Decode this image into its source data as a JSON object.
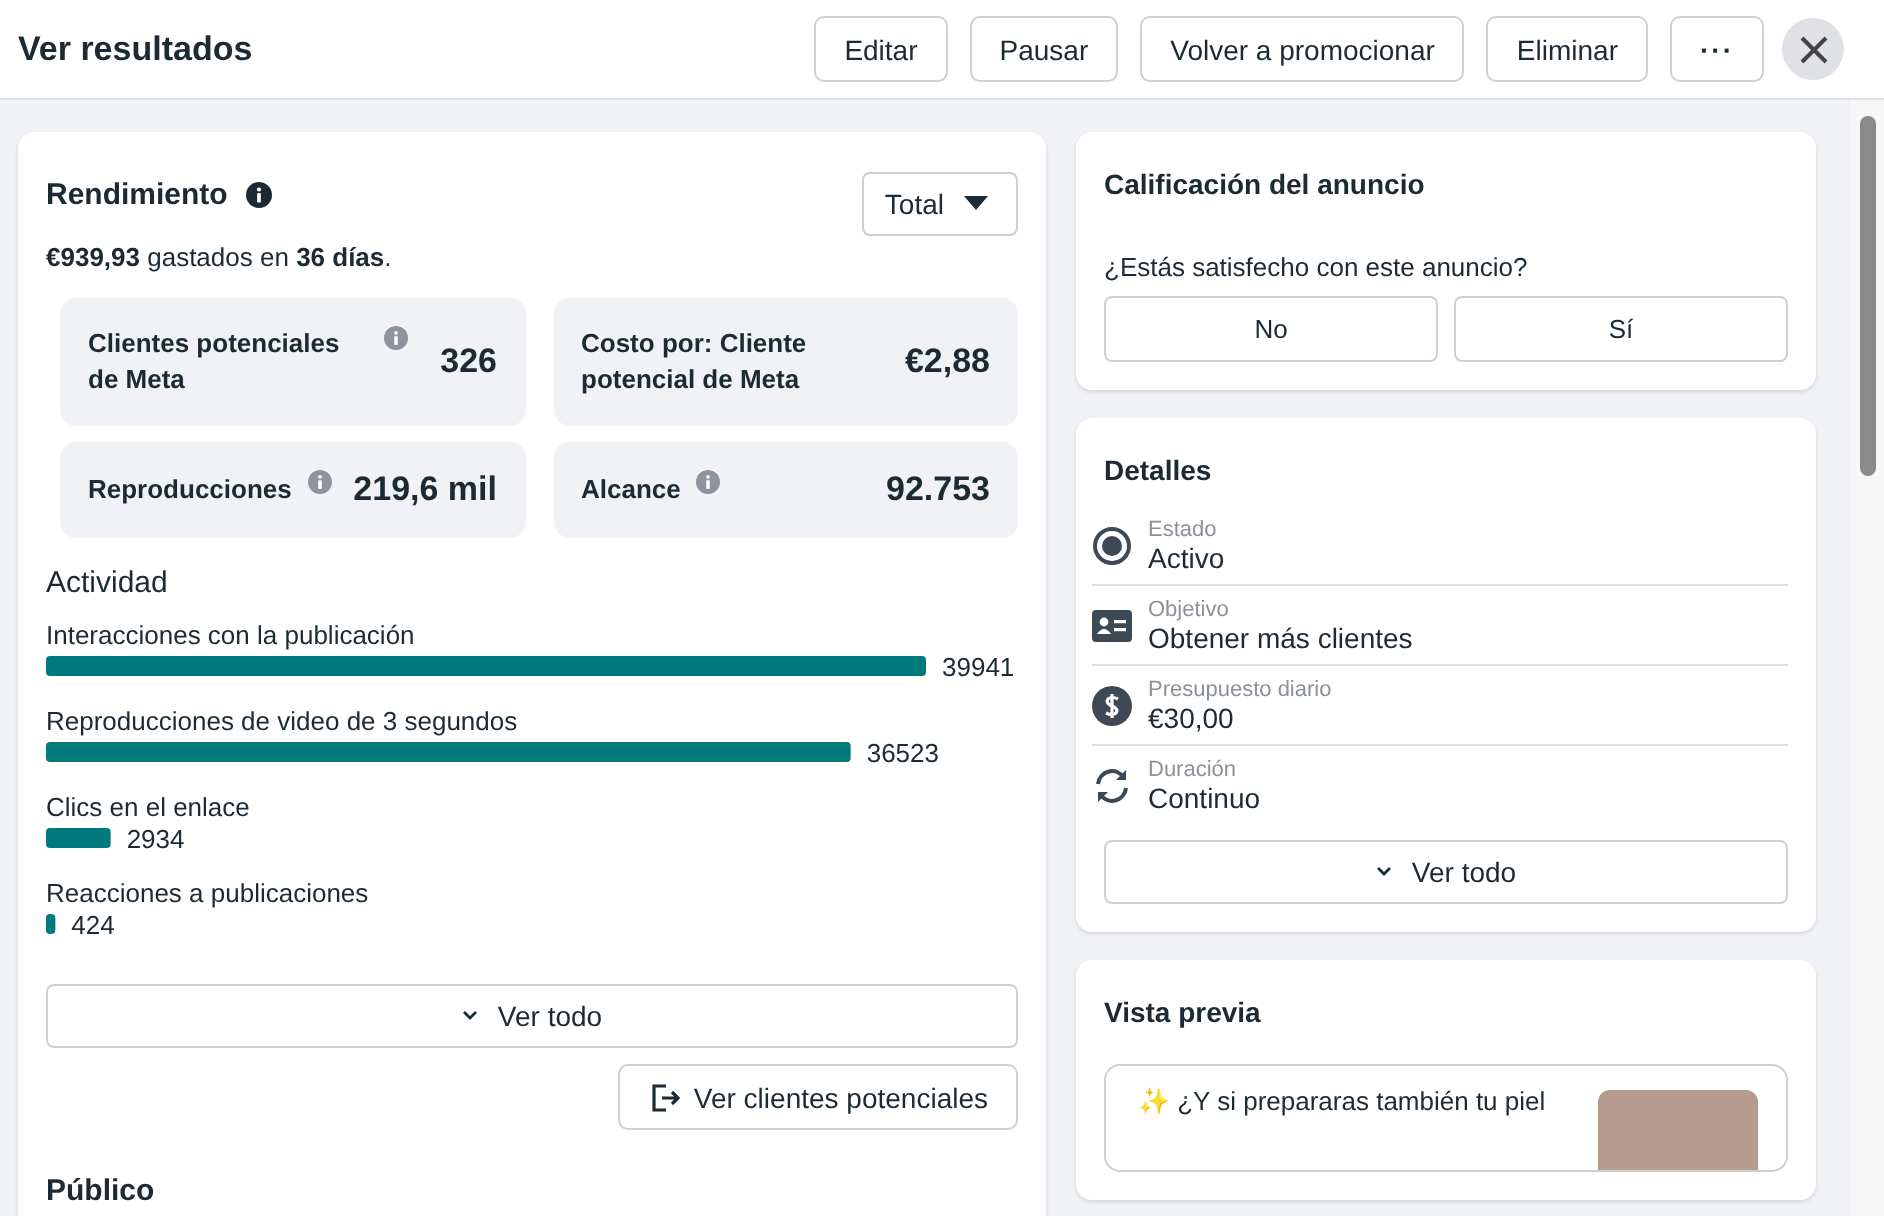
{
  "header": {
    "title": "Ver resultados",
    "buttons": [
      "Editar",
      "Pausar",
      "Volver a promocionar",
      "Eliminar"
    ],
    "more_label": "···"
  },
  "performance": {
    "title": "Rendimiento",
    "period": "Total",
    "spent": "**€939,93** gastados en **36 días**.",
    "metrics": [
      {
        "label": "Clientes potenciales de Meta",
        "value": "326",
        "info": true
      },
      {
        "label": "Costo por: Cliente potencial de Meta",
        "value": "€2,88",
        "info": false
      },
      {
        "label": "Reproducciones",
        "value": "219,6 mil",
        "info": true
      },
      {
        "label": "Alcance",
        "value": "92.753",
        "info": true
      }
    ],
    "chart_data": {
      "type": "bar",
      "orientation": "horizontal",
      "title": "Actividad",
      "categories": [
        "Interacciones con la publicación",
        "Reproducciones de video de 3 segundos",
        "Clics en el enlace",
        "Reacciones a publicaciones"
      ],
      "values": [
        39941,
        36523,
        2934,
        424
      ],
      "data_labels": true
    },
    "see_all": "Ver todo",
    "leads_button": "Ver clientes potenciales",
    "audience_title": "Público"
  },
  "rating": {
    "title": "Calificación del anuncio",
    "question": "¿Estás satisfecho con este anuncio?",
    "options": [
      "No",
      "Sí"
    ]
  },
  "details": {
    "title": "Detalles",
    "items": [
      {
        "kind": "status",
        "label": "Estado",
        "value": "Activo"
      },
      {
        "kind": "objective",
        "label": "Objetivo",
        "value": "Obtener más clientes"
      },
      {
        "kind": "budget",
        "label": "Presupuesto diario",
        "value": "€30,00"
      },
      {
        "kind": "duration",
        "label": "Duración",
        "value": "Continuo"
      }
    ],
    "see_all": "Ver todo"
  },
  "preview": {
    "title": "Vista previa",
    "text": "✨ ¿Y si prepararas también tu piel"
  }
}
